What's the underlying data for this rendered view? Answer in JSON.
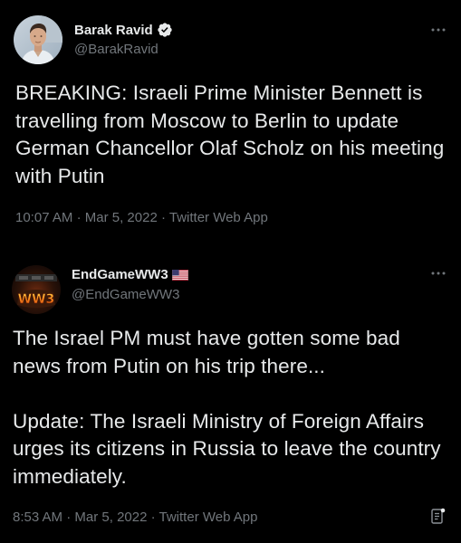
{
  "tweets": [
    {
      "author": {
        "name": "Barak Ravid",
        "handle": "@BarakRavid",
        "verified": true,
        "avatar": "profile-photo"
      },
      "text": "BREAKING: Israeli Prime Minister Bennett is travelling from Moscow to Berlin to update German Chancellor Olaf Scholz on his meeting with Putin",
      "time": "10:07 AM",
      "date": "Mar 5, 2022",
      "source": "Twitter Web App",
      "separator": "·"
    },
    {
      "author": {
        "name": "EndGameWW3",
        "handle": "@EndGameWW3",
        "flag": "🇺🇸",
        "avatar": "ww3-logo",
        "avatar_text": "WW3"
      },
      "text": "The Israel PM must have gotten some bad news from Putin on his trip there...\n\nUpdate: The Israeli Ministry of Foreign Affairs urges its citizens in Russia to leave the country immediately.",
      "time": "8:53 AM",
      "date": "Mar 5, 2022",
      "source": "Twitter Web App",
      "separator": "·"
    }
  ],
  "icons": {
    "more": "more-options-icon",
    "verified": "verified-badge-icon",
    "corner": "document-icon"
  },
  "colors": {
    "background": "#000000",
    "text_primary": "#e7e9ea",
    "text_secondary": "#71767b",
    "verified_badge": "#e7e9ea"
  }
}
